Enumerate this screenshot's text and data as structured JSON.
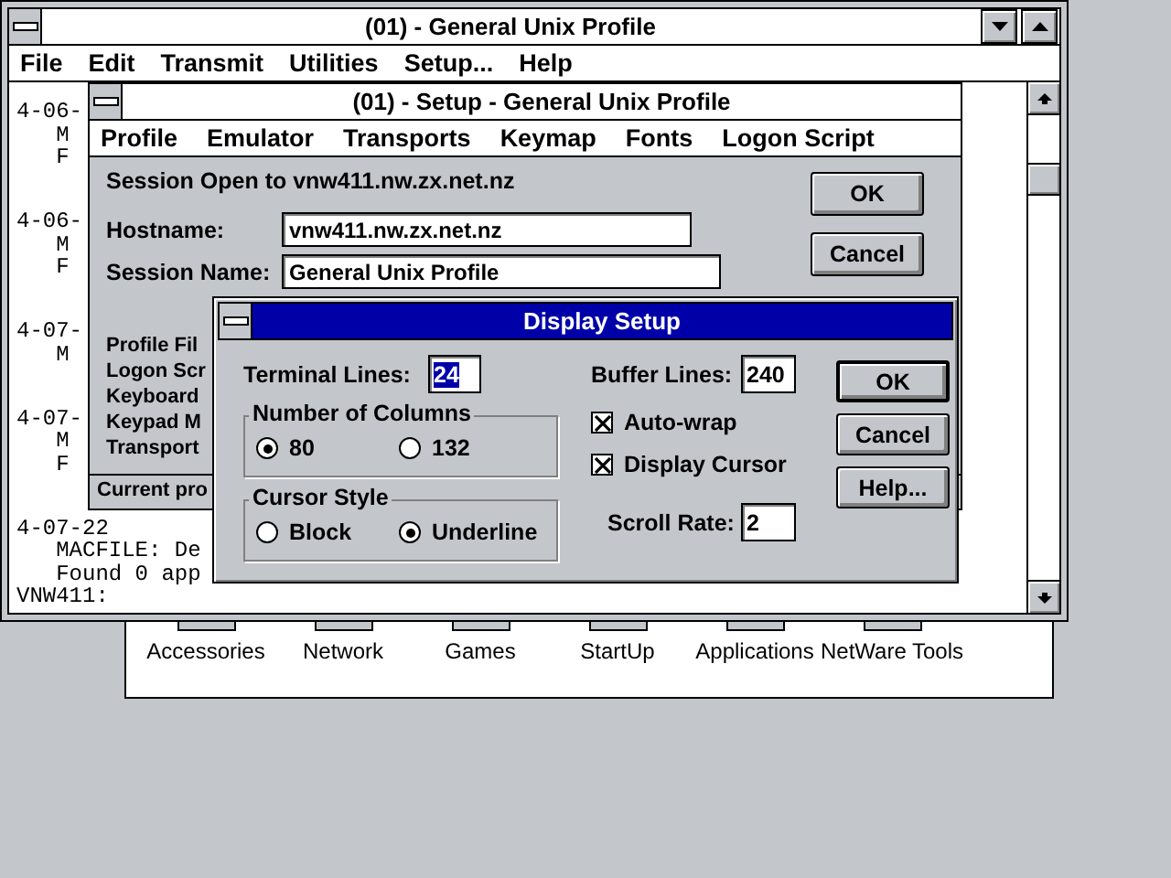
{
  "terminal_window": {
    "title": "(01) - General Unix Profile",
    "menu": [
      "File",
      "Edit",
      "Transmit",
      "Utilities",
      "Setup...",
      "Help"
    ],
    "blocks": [
      {
        "lines": [
          "4-06-",
          "   M",
          "   F"
        ]
      },
      {
        "lines": [
          "4-06-",
          "   M",
          "   F"
        ]
      },
      {
        "lines": [
          "4-07-",
          "   M"
        ]
      },
      {
        "lines": [
          "4-07-",
          "   M",
          "   F"
        ]
      },
      {
        "lines": [
          "4-07-22",
          "   MACFILE: De",
          "   Found 0 app",
          "VNW411:"
        ]
      }
    ]
  },
  "program_groups": [
    "Accessories",
    "Network",
    "Games",
    "StartUp",
    "Applications",
    "NetWare Tools"
  ],
  "setup_window": {
    "title": "(01) - Setup - General Unix Profile",
    "menu": [
      "Profile",
      "Emulator",
      "Transports",
      "Keymap",
      "Fonts",
      "Logon Script"
    ],
    "session_status": "Session Open to vnw411.nw.zx.net.nz",
    "fields": [
      {
        "label": "Hostname:",
        "value": "vnw411.nw.zx.net.nz"
      },
      {
        "label": "Session Name:",
        "value": "General Unix Profile"
      }
    ],
    "labels": [
      "Profile Fil",
      "Logon Scr",
      "Keyboard",
      "Keypad M",
      "Transport"
    ],
    "buttons": [
      "OK",
      "Cancel"
    ],
    "status_bar": "Current pro"
  },
  "display_setup": {
    "title": "Display Setup",
    "terminal_lines": {
      "label": "Terminal Lines:",
      "value": "24",
      "selected": true
    },
    "columns": {
      "title": "Number of Columns",
      "options": [
        {
          "label": "80",
          "selected": true
        },
        {
          "label": "132",
          "selected": false
        }
      ]
    },
    "cursor_style": {
      "title": "Cursor Style",
      "options": [
        {
          "label": "Block",
          "selected": false
        },
        {
          "label": "Underline",
          "selected": true
        }
      ]
    },
    "buffer_lines": {
      "label": "Buffer Lines:",
      "value": "240"
    },
    "checkboxes": [
      {
        "label": "Auto-wrap",
        "checked": true
      },
      {
        "label": "Display Cursor",
        "checked": true
      }
    ],
    "scroll_rate": {
      "label": "Scroll Rate:",
      "value": "2"
    },
    "buttons": [
      {
        "label": "OK",
        "default": true
      },
      {
        "label": "Cancel",
        "default": false
      },
      {
        "label": "Help...",
        "default": false
      }
    ]
  }
}
